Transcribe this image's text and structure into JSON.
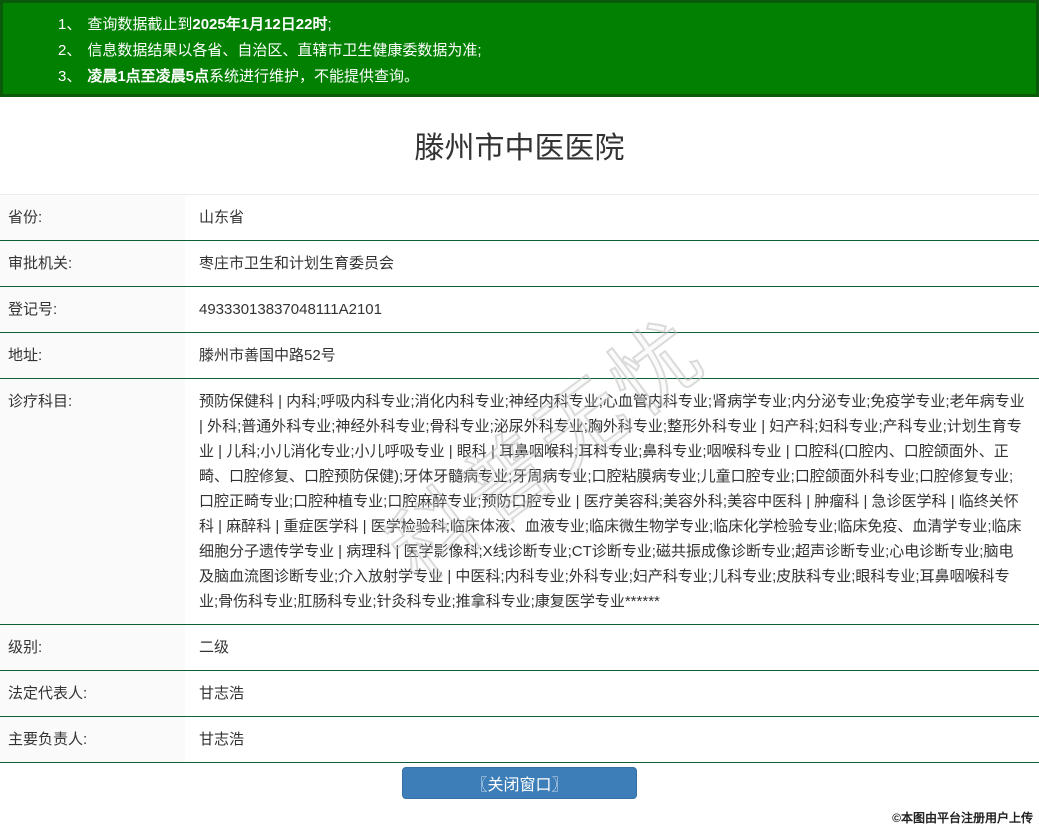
{
  "notice_bar": {
    "items": [
      {
        "num": "1、",
        "pre": "查询数据截止到",
        "bold": "2025年1月12日22时",
        "post": ";"
      },
      {
        "num": "2、",
        "pre": "信息数据结果以各省、自治区、直辖市卫生健康委数据为准;",
        "bold": "",
        "post": ""
      },
      {
        "num": "3、",
        "pre": "",
        "bold": "凌晨1点至凌晨5点",
        "post": "系统进行维护，不能提供查询。"
      }
    ]
  },
  "title": "滕州市中医医院",
  "info_table": {
    "rows": [
      {
        "label": "省份:",
        "value": "山东省"
      },
      {
        "label": "审批机关:",
        "value": "枣庄市卫生和计划生育委员会"
      },
      {
        "label": "登记号:",
        "value": "49333013837048111A2101"
      },
      {
        "label": "地址:",
        "value": "滕州市善国中路52号"
      },
      {
        "label": "诊疗科目:",
        "value": "预防保健科 | 内科;呼吸内科专业;消化内科专业;神经内科专业;心血管内科专业;肾病学专业;内分泌专业;免疫学专业;老年病专业 | 外科;普通外科专业;神经外科专业;骨科专业;泌尿外科专业;胸外科专业;整形外科专业 | 妇产科;妇科专业;产科专业;计划生育专业 | 儿科;小儿消化专业;小儿呼吸专业 | 眼科 | 耳鼻咽喉科;耳科专业;鼻科专业;咽喉科专业 | 口腔科(口腔内、口腔颌面外、正畸、口腔修复、口腔预防保健);牙体牙髓病专业;牙周病专业;口腔粘膜病专业;儿童口腔专业;口腔颌面外科专业;口腔修复专业;口腔正畸专业;口腔种植专业;口腔麻醉专业;预防口腔专业 | 医疗美容科;美容外科;美容中医科 | 肿瘤科 | 急诊医学科 | 临终关怀科 | 麻醉科 | 重症医学科 | 医学检验科;临床体液、血液专业;临床微生物学专业;临床化学检验专业;临床免疫、血清学专业;临床细胞分子遗传学专业 | 病理科 | 医学影像科;X线诊断专业;CT诊断专业;磁共振成像诊断专业;超声诊断专业;心电诊断专业;脑电及脑血流图诊断专业;介入放射学专业 | 中医科;内科专业;外科专业;妇产科专业;儿科专业;皮肤科专业;眼科专业;耳鼻咽喉科专业;骨伤科专业;肛肠科专业;针灸科专业;推拿科专业;康复医学专业******"
      },
      {
        "label": "级别:",
        "value": "二级"
      },
      {
        "label": "法定代表人:",
        "value": "甘志浩"
      },
      {
        "label": "主要负责人:",
        "value": "甘志浩"
      }
    ]
  },
  "close_button": {
    "label": "〖关闭窗口〗"
  },
  "watermark_text": "科普无忧",
  "upload_note": "©本图由平台注册用户上传",
  "colors": {
    "notice_bg": "#018001",
    "notice_border": "#0b5a0b",
    "row_divider": "#0e5f38",
    "button_bg": "#3d7eb8"
  }
}
